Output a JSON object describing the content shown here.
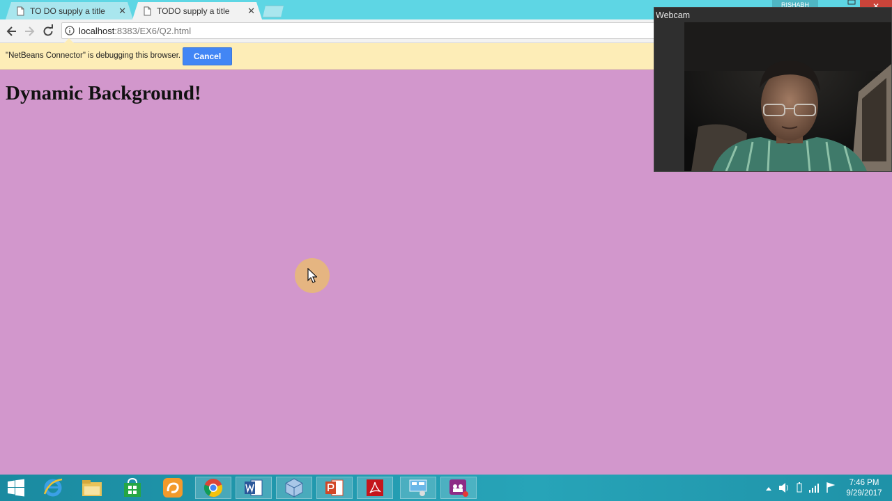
{
  "tabs": [
    {
      "title": "TO DO supply a title",
      "active": false
    },
    {
      "title": "TODO supply a title",
      "active": true
    }
  ],
  "window": {
    "user_label": "RISHABH"
  },
  "address_bar": {
    "host": "localhost",
    "rest": ":8383/EX6/Q2.html"
  },
  "infobar": {
    "message": "\"NetBeans Connector\" is debugging this browser.",
    "cancel_label": "Cancel"
  },
  "page": {
    "heading": "Dynamic Background!",
    "background_color": "#d297cc"
  },
  "webcam": {
    "title": "Webcam"
  },
  "taskbar": {
    "apps": [
      "start-icon",
      "internet-explorer-icon",
      "file-explorer-icon",
      "store-icon",
      "uc-browser-icon",
      "chrome-icon",
      "word-icon",
      "netbeans-icon",
      "powerpoint-icon",
      "acrobat-icon",
      "network-icon",
      "recorder-icon"
    ],
    "clock_time": "7:46 PM",
    "clock_date": "9/29/2017"
  },
  "colors": {
    "tabstrip": "#5ed6e4",
    "cancel_button": "#4286f5",
    "infobar": "#fdedb7"
  }
}
